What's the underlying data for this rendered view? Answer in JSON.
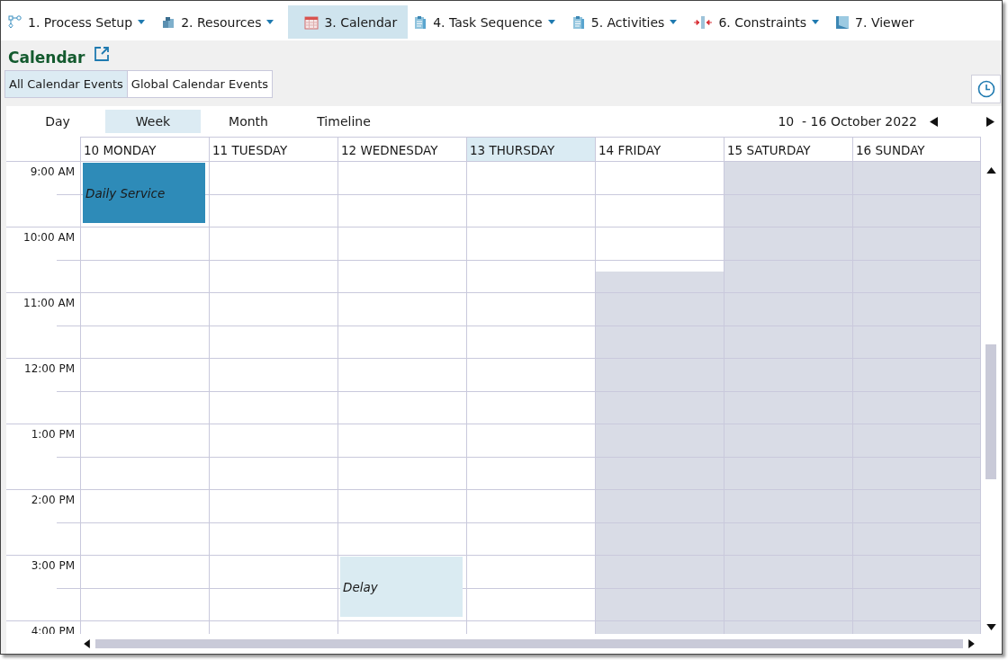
{
  "nav": [
    {
      "label": "1. Process Setup",
      "dropdown": true,
      "selected": false
    },
    {
      "label": "2. Resources",
      "dropdown": true,
      "selected": false
    },
    {
      "label": "3. Calendar",
      "dropdown": false,
      "selected": true
    },
    {
      "label": "4. Task Sequence",
      "dropdown": true,
      "selected": false
    },
    {
      "label": "5. Activities",
      "dropdown": true,
      "selected": false
    },
    {
      "label": "6. Constraints",
      "dropdown": true,
      "selected": false
    },
    {
      "label": "7. Viewer",
      "dropdown": false,
      "selected": false
    }
  ],
  "page_title": "Calendar",
  "event_tabs": [
    {
      "label": "All Calendar Events",
      "selected": true
    },
    {
      "label": "Global Calendar Events",
      "selected": false
    }
  ],
  "views": [
    {
      "label": "Day",
      "selected": false
    },
    {
      "label": "Week",
      "selected": true
    },
    {
      "label": "Month",
      "selected": false
    },
    {
      "label": "Timeline",
      "selected": false
    }
  ],
  "date_range": "10  - 16 October 2022",
  "days": [
    {
      "label": "10 MONDAY",
      "selected": false
    },
    {
      "label": "11 TUESDAY",
      "selected": false
    },
    {
      "label": "12 WEDNESDAY",
      "selected": false
    },
    {
      "label": "13 THURSDAY",
      "selected": true
    },
    {
      "label": "14 FRIDAY",
      "selected": false
    },
    {
      "label": "15 SATURDAY",
      "selected": false
    },
    {
      "label": "16 SUNDAY",
      "selected": false
    }
  ],
  "hours": [
    {
      "label": "9:00 AM",
      "cells": [
        {
          "working": true,
          "closes_early": false,
          "event": {
            "title": "Daily Service",
            "color": "#2e8bb8"
          }
        },
        {
          "working": true,
          "closes_early": false
        },
        {
          "working": true,
          "closes_early": false
        },
        {
          "working": true,
          "closes_early": false
        },
        {
          "working": true,
          "closes_early": false
        },
        {
          "working": false,
          "closes_early": false
        },
        {
          "working": false,
          "closes_early": false
        }
      ]
    },
    {
      "label": "10:00 AM",
      "cells": [
        {
          "working": true,
          "closes_early": false
        },
        {
          "working": true,
          "closes_early": false
        },
        {
          "working": true,
          "closes_early": false
        },
        {
          "working": true,
          "closes_early": false
        },
        {
          "working": true,
          "closes_early": true
        },
        {
          "working": false,
          "closes_early": false
        },
        {
          "working": false,
          "closes_early": false
        }
      ]
    },
    {
      "label": "11:00 AM",
      "cells": [
        {
          "working": true,
          "closes_early": false
        },
        {
          "working": true,
          "closes_early": false
        },
        {
          "working": true,
          "closes_early": false
        },
        {
          "working": true,
          "closes_early": false
        },
        {
          "working": false,
          "closes_early": false
        },
        {
          "working": false,
          "closes_early": false
        },
        {
          "working": false,
          "closes_early": false
        }
      ]
    },
    {
      "label": "12:00 PM",
      "cells": [
        {
          "working": true,
          "closes_early": false
        },
        {
          "working": true,
          "closes_early": false
        },
        {
          "working": true,
          "closes_early": false
        },
        {
          "working": true,
          "closes_early": false
        },
        {
          "working": false,
          "closes_early": false
        },
        {
          "working": false,
          "closes_early": false
        },
        {
          "working": false,
          "closes_early": false
        }
      ]
    },
    {
      "label": "1:00 PM",
      "cells": [
        {
          "working": true,
          "closes_early": false
        },
        {
          "working": true,
          "closes_early": false
        },
        {
          "working": true,
          "closes_early": false
        },
        {
          "working": true,
          "closes_early": false
        },
        {
          "working": false,
          "closes_early": false
        },
        {
          "working": false,
          "closes_early": false
        },
        {
          "working": false,
          "closes_early": false
        }
      ]
    },
    {
      "label": "2:00 PM",
      "cells": [
        {
          "working": true,
          "closes_early": false
        },
        {
          "working": true,
          "closes_early": false
        },
        {
          "working": true,
          "closes_early": false
        },
        {
          "working": true,
          "closes_early": false
        },
        {
          "working": false,
          "closes_early": false
        },
        {
          "working": false,
          "closes_early": false
        },
        {
          "working": false,
          "closes_early": false
        }
      ]
    },
    {
      "label": "3:00 PM",
      "cells": [
        {
          "working": true,
          "closes_early": false
        },
        {
          "working": true,
          "closes_early": false
        },
        {
          "working": true,
          "closes_early": false,
          "event": {
            "title": "Delay",
            "color": "#daebf2"
          }
        },
        {
          "working": true,
          "closes_early": false
        },
        {
          "working": false,
          "closes_early": false
        },
        {
          "working": false,
          "closes_early": false
        },
        {
          "working": false,
          "closes_early": false
        }
      ]
    },
    {
      "label": "4:00 PM",
      "cells": [
        {
          "working": true,
          "closes_early": false
        },
        {
          "working": true,
          "closes_early": false
        },
        {
          "working": true,
          "closes_early": false
        },
        {
          "working": true,
          "closes_early": false
        },
        {
          "working": false,
          "closes_early": false
        },
        {
          "working": false,
          "closes_early": false
        },
        {
          "working": false,
          "closes_early": false
        }
      ]
    }
  ]
}
